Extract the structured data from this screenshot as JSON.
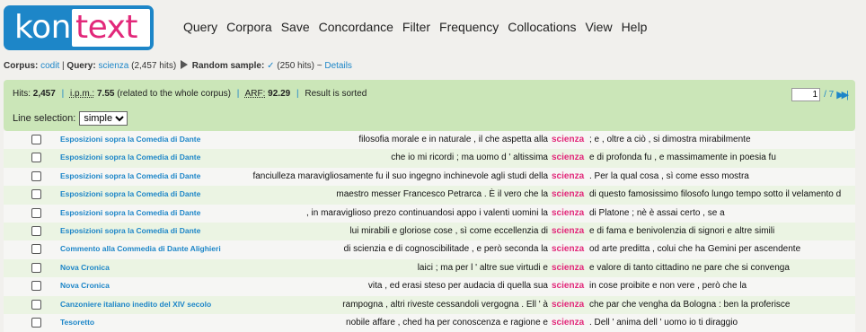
{
  "logo": {
    "part1": "kon",
    "part2": "text"
  },
  "menu": [
    "Query",
    "Corpora",
    "Save",
    "Concordance",
    "Filter",
    "Frequency",
    "Collocations",
    "View",
    "Help"
  ],
  "crumbs": {
    "corpus_label": "Corpus:",
    "corpus_value": "codit",
    "sep": "|",
    "query_label": "Query:",
    "query_value": "scienza",
    "query_hits": "(2,457 hits)",
    "sample_label": "Random sample:",
    "sample_check": "✓",
    "sample_hits": "(250 hits)",
    "tilde": "~",
    "details": "Details"
  },
  "info": {
    "hits_label": "Hits:",
    "hits_value": "2,457",
    "ipm_label": "i.p.m.:",
    "ipm_value": "7.55",
    "ipm_note": "(related to the whole corpus)",
    "arf_label": "ARF:",
    "arf_value": "92.29",
    "sorted": "Result is sorted"
  },
  "pager": {
    "page": "1",
    "total": "/ 7",
    "nav": "▶▶|"
  },
  "line_selection": {
    "label": "Line selection:",
    "value": "simple"
  },
  "rows": [
    {
      "src": "Esposizioni sopra la Comedia di Dante",
      "left": "filosofia morale e in naturale , il che aspetta alla",
      "kwic": "scienza",
      "right": "; e , oltre a ciò , si dimostra mirabilmente"
    },
    {
      "src": "Esposizioni sopra la Comedia di Dante",
      "left": "che io mi ricordi ; ma uomo d ' altissima",
      "kwic": "scienza",
      "right": "e di profonda fu , e massimamente in poesia fu"
    },
    {
      "src": "Esposizioni sopra la Comedia di Dante",
      "left": "fanciulleza maravigliosamente fu il suo ingegno inchinevole agli studi della",
      "kwic": "scienza",
      "right": ". Per la qual cosa , sì come esso mostra"
    },
    {
      "src": "Esposizioni sopra la Comedia di Dante",
      "left": "maestro messer Francesco Petrarca . È il vero che la",
      "kwic": "scienza",
      "right": "di questo famosissimo filosofo lungo tempo sotto il velamento d"
    },
    {
      "src": "Esposizioni sopra la Comedia di Dante",
      "left": ", in maraviglioso prezo continuandosi appo i valenti uomini la",
      "kwic": "scienza",
      "right": "di Platone ; nè è assai certo , se a"
    },
    {
      "src": "Esposizioni sopra la Comedia di Dante",
      "left": "lui mirabili e gloriose cose , sì come eccellenzia di",
      "kwic": "scienza",
      "right": "e di fama e benivolenzia di signori e altre simili"
    },
    {
      "src": "Commento alla Commedia di Dante Alighieri",
      "left": "di scienzia e di cognoscibilitade , e però seconda la",
      "kwic": "scienza",
      "right": "od arte preditta , colui che ha Gemini per ascendente"
    },
    {
      "src": "Nova Cronica",
      "left": "laici ; ma per l ' altre sue virtudi e",
      "kwic": "scienza",
      "right": "e valore di tanto cittadino ne pare che si convenga"
    },
    {
      "src": "Nova Cronica",
      "left": "vita , ed erasi steso per audacia di quella sua",
      "kwic": "scienza",
      "right": "in cose proibite e non vere , però che la"
    },
    {
      "src": "Canzoniere italiano inedito del XIV secolo",
      "left": "rampogna , altri riveste cessandoli vergogna . Ell ' à",
      "kwic": "scienza",
      "right": "che par che vengha da Bologna : ben la proferisce"
    },
    {
      "src": "Tesoretto",
      "left": "nobile affare , ched ha per conoscenza e ragione e",
      "kwic": "scienza",
      "right": ". Dell ' anima dell ' uomo io ti diraggio"
    }
  ]
}
